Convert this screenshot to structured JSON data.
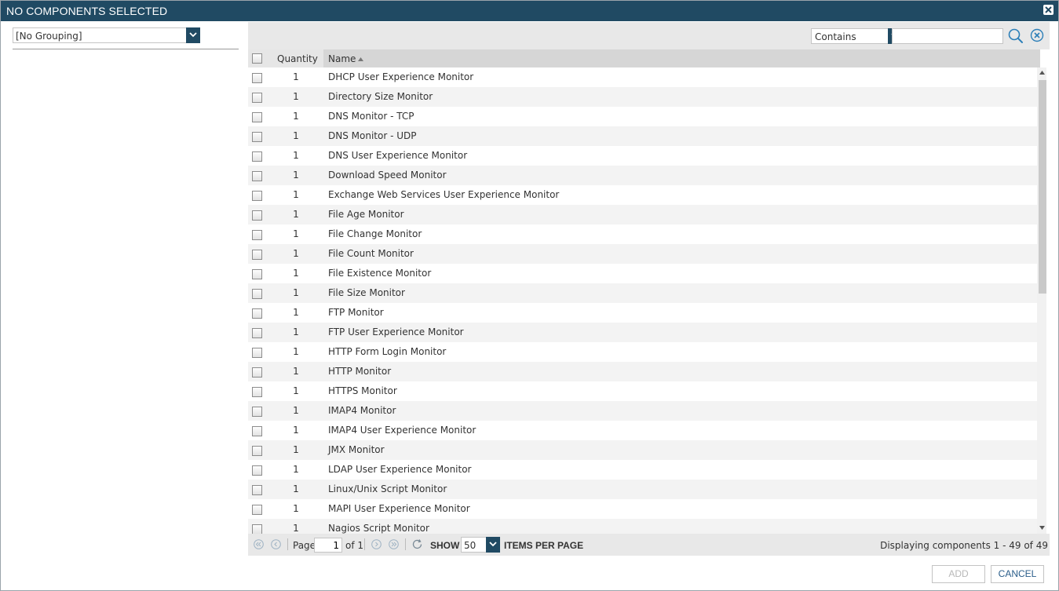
{
  "title": "NO COMPONENTS SELECTED",
  "grouping": {
    "selected": "[No Grouping]"
  },
  "filter": {
    "mode": "Contains",
    "search_value": ""
  },
  "grid": {
    "columns": {
      "quantity": "Quantity",
      "name": "Name"
    },
    "sort": {
      "column": "Name",
      "direction": "ascending"
    },
    "rows": [
      {
        "qty": "1",
        "name": "DHCP User Experience Monitor"
      },
      {
        "qty": "1",
        "name": "Directory Size Monitor"
      },
      {
        "qty": "1",
        "name": "DNS Monitor - TCP"
      },
      {
        "qty": "1",
        "name": "DNS Monitor - UDP"
      },
      {
        "qty": "1",
        "name": "DNS User Experience Monitor"
      },
      {
        "qty": "1",
        "name": "Download Speed Monitor"
      },
      {
        "qty": "1",
        "name": "Exchange Web Services User Experience Monitor"
      },
      {
        "qty": "1",
        "name": "File Age Monitor"
      },
      {
        "qty": "1",
        "name": "File Change Monitor"
      },
      {
        "qty": "1",
        "name": "File Count Monitor"
      },
      {
        "qty": "1",
        "name": "File Existence Monitor"
      },
      {
        "qty": "1",
        "name": "File Size Monitor"
      },
      {
        "qty": "1",
        "name": "FTP Monitor"
      },
      {
        "qty": "1",
        "name": "FTP User Experience Monitor"
      },
      {
        "qty": "1",
        "name": "HTTP Form Login Monitor"
      },
      {
        "qty": "1",
        "name": "HTTP Monitor"
      },
      {
        "qty": "1",
        "name": "HTTPS Monitor"
      },
      {
        "qty": "1",
        "name": "IMAP4 Monitor"
      },
      {
        "qty": "1",
        "name": "IMAP4 User Experience Monitor"
      },
      {
        "qty": "1",
        "name": "JMX Monitor"
      },
      {
        "qty": "1",
        "name": "LDAP User Experience Monitor"
      },
      {
        "qty": "1",
        "name": "Linux/Unix Script Monitor"
      },
      {
        "qty": "1",
        "name": "MAPI User Experience Monitor"
      },
      {
        "qty": "1",
        "name": "Nagios Script Monitor"
      }
    ]
  },
  "pager": {
    "page_label": "Page",
    "page_value": "1",
    "of_label": "of 1",
    "show_label": "SHOW",
    "per_page": "50",
    "items_label": "ITEMS PER PAGE",
    "displaying": "Displaying components 1 - 49 of 49"
  },
  "buttons": {
    "add": "ADD",
    "cancel": "CANCEL"
  },
  "icons": {
    "close": "close-icon",
    "dropdown": "chevron-down-icon",
    "search": "search-icon",
    "clear": "clear-circle-icon",
    "first": "first-page-icon",
    "prev": "prev-page-icon",
    "next": "next-page-icon",
    "last": "last-page-icon",
    "refresh": "refresh-icon",
    "sort": "sort-ascending-icon"
  },
  "colors": {
    "titlebar": "#204a63",
    "accent": "#204a63",
    "cancel_text": "#2a5d8a",
    "disabled_text": "#b8b8b8"
  }
}
